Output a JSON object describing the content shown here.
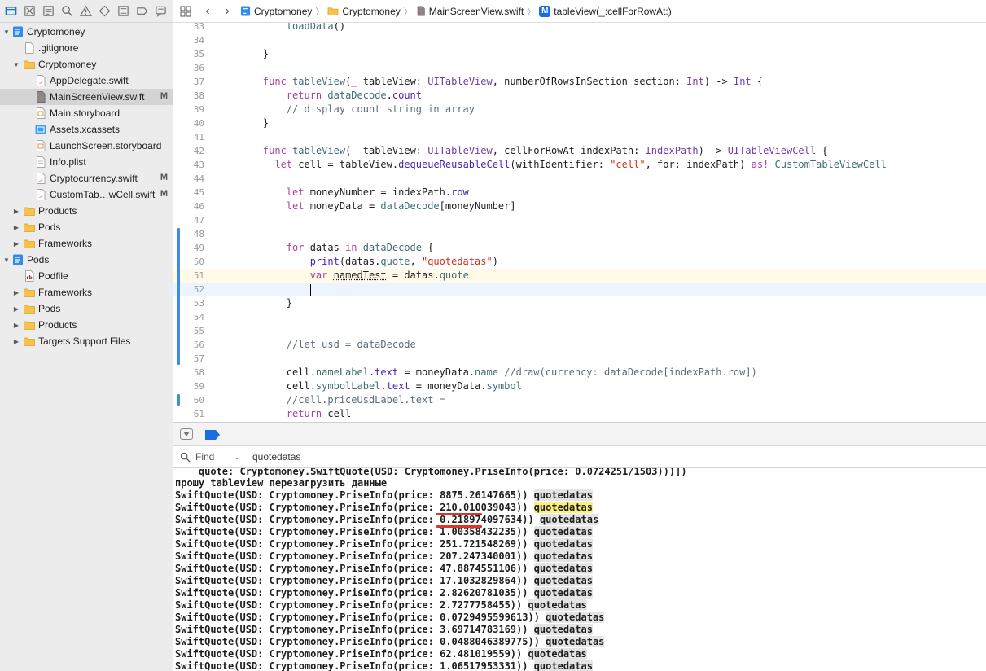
{
  "navigator": {
    "items": [
      {
        "label": "Cryptomoney",
        "icon": "xcode-project-icon",
        "badge": ""
      },
      {
        "label": ".gitignore",
        "icon": "file-icon",
        "badge": ""
      },
      {
        "label": "Cryptomoney",
        "icon": "folder-icon",
        "badge": ""
      },
      {
        "label": "AppDelegate.swift",
        "icon": "swift-file-icon",
        "badge": ""
      },
      {
        "label": "MainScreenView.swift",
        "icon": "swift-file-icon",
        "badge": "M"
      },
      {
        "label": "Main.storyboard",
        "icon": "storyboard-icon",
        "badge": ""
      },
      {
        "label": "Assets.xcassets",
        "icon": "assets-icon",
        "badge": ""
      },
      {
        "label": "LaunchScreen.storyboard",
        "icon": "storyboard-icon",
        "badge": ""
      },
      {
        "label": "Info.plist",
        "icon": "plist-icon",
        "badge": ""
      },
      {
        "label": "Cryptocurrency.swift",
        "icon": "swift-file-icon",
        "badge": "M"
      },
      {
        "label": "CustomTab…wCell.swift",
        "icon": "swift-file-icon",
        "badge": "M"
      },
      {
        "label": "Products",
        "icon": "folder-icon",
        "badge": ""
      },
      {
        "label": "Pods",
        "icon": "folder-icon",
        "badge": ""
      },
      {
        "label": "Frameworks",
        "icon": "folder-icon",
        "badge": ""
      },
      {
        "label": "Pods",
        "icon": "xcode-project-icon",
        "badge": ""
      },
      {
        "label": "Podfile",
        "icon": "ruby-file-icon",
        "badge": ""
      },
      {
        "label": "Frameworks",
        "icon": "folder-icon",
        "badge": ""
      },
      {
        "label": "Pods",
        "icon": "folder-icon",
        "badge": ""
      },
      {
        "label": "Products",
        "icon": "folder-icon",
        "badge": ""
      },
      {
        "label": "Targets Support Files",
        "icon": "folder-icon",
        "badge": ""
      }
    ]
  },
  "jumpbar": {
    "project": "Cryptomoney",
    "group": "Cryptomoney",
    "file": "MainScreenView.swift",
    "symbol": "tableView(_:cellForRowAt:)"
  },
  "editor": {
    "lines": [
      {
        "n": "33",
        "html": "        <span class='fn'>loadData</span>()"
      },
      {
        "n": "34",
        "html": ""
      },
      {
        "n": "35",
        "html": "    }"
      },
      {
        "n": "36",
        "html": ""
      },
      {
        "n": "37",
        "html": "    <span class='kw'>func</span> <span class='fn'>tableView</span>(<span class='kw'>_</span> tableView: <span class='ty'>UITableView</span>, numberOfRowsInSection section: <span class='ty'>Int</span>) -&gt; <span class='ty'>Int</span> {"
      },
      {
        "n": "38",
        "html": "        <span class='kw'>return</span> <span class='fn'>dataDecode</span>.<span class='prop'>count</span>"
      },
      {
        "n": "39",
        "html": "        <span class='cm'>// display count string in array</span>"
      },
      {
        "n": "40",
        "html": "    }"
      },
      {
        "n": "41",
        "html": ""
      },
      {
        "n": "42",
        "html": "    <span class='kw'>func</span> <span class='fn'>tableView</span>(<span class='kw'>_</span> tableView: <span class='ty'>UITableView</span>, cellForRowAt indexPath: <span class='ty'>IndexPath</span>) -&gt; <span class='ty'>UITableViewCell</span> {"
      },
      {
        "n": "43",
        "html": "      <span class='kw'>let</span> cell = tableView.<span class='prop'>dequeueReusableCell</span>(withIdentifier: <span class='str'>\"cell\"</span>, for: indexPath) <span class='kw'>as!</span> <span class='fn'>CustomTableViewCell</span>"
      },
      {
        "n": "44",
        "html": ""
      },
      {
        "n": "45",
        "html": "        <span class='kw'>let</span> moneyNumber = indexPath.<span class='prop'>row</span>"
      },
      {
        "n": "46",
        "html": "        <span class='kw'>let</span> moneyData = <span class='fn'>dataDecode</span>[moneyNumber]"
      },
      {
        "n": "47",
        "html": ""
      },
      {
        "n": "48",
        "html": ""
      },
      {
        "n": "49",
        "html": "        <span class='kw'>for</span> datas <span class='kw'>in</span> <span class='fn'>dataDecode</span> {"
      },
      {
        "n": "50",
        "html": "            <span class='prop'>print</span>(datas.<span class='fn'>quote</span>, <span class='str'>\"quotedatas\"</span>)"
      },
      {
        "n": "51",
        "html": "            <span class='kw'>var</span> <span style='text-decoration: underline dotted'>namedTest</span> = datas.<span class='fn'>quote</span>"
      },
      {
        "n": "52",
        "html": "            "
      },
      {
        "n": "53",
        "html": "        }"
      },
      {
        "n": "54",
        "html": ""
      },
      {
        "n": "55",
        "html": ""
      },
      {
        "n": "56",
        "html": "        <span class='cm'>//let usd = dataDecode</span>"
      },
      {
        "n": "57",
        "html": ""
      },
      {
        "n": "58",
        "html": "        cell.<span class='fn'>nameLabel</span>.<span class='prop'>text</span> = moneyData.<span class='fn'>name</span> <span class='cm'>//draw(currency: dataDecode[indexPath.row])</span>"
      },
      {
        "n": "59",
        "html": "        cell.<span class='fn'>symbolLabel</span>.<span class='prop'>text</span> = moneyData.<span class='fn'>symbol</span>"
      },
      {
        "n": "60",
        "html": "        <span class='cm'>//cell.priceUsdLabel.text =</span>"
      },
      {
        "n": "61",
        "html": "        <span class='kw'>return</span> cell"
      }
    ]
  },
  "find_bar": {
    "mode_label": "Find",
    "query": "quotedatas"
  },
  "console": {
    "partial_line": "    quote: Cryptomoney.SwiftQuote(USD: Cryptomoney.PriseInfo(price: 0.0724251/1503)))])",
    "message_line": "прошу tableview перезагрузить данные",
    "prefix": "SwiftQuote(USD: Cryptomoney.PriseInfo(price: ",
    "suffix": ")) ",
    "match_word": "quotedatas",
    "prices": [
      "8875.26147665",
      "210.010039043",
      "0.218974097634",
      "1.00358432235",
      "251.721548269",
      "207.247340001",
      "47.8874551106",
      "17.1032829864",
      "2.82620781035",
      "2.7277758455",
      "0.0729495599613",
      "3.69714783169",
      "0.0488046389775",
      "62.481019559",
      "1.06517953331"
    ]
  },
  "colors": {
    "accent": "#1a6fe0",
    "keyword": "#ad3da4",
    "type": "#703daa",
    "string": "#d12f1b",
    "comment": "#5d6c79",
    "match_current": "#fbf17a",
    "annotation_red": "#e0342b"
  }
}
